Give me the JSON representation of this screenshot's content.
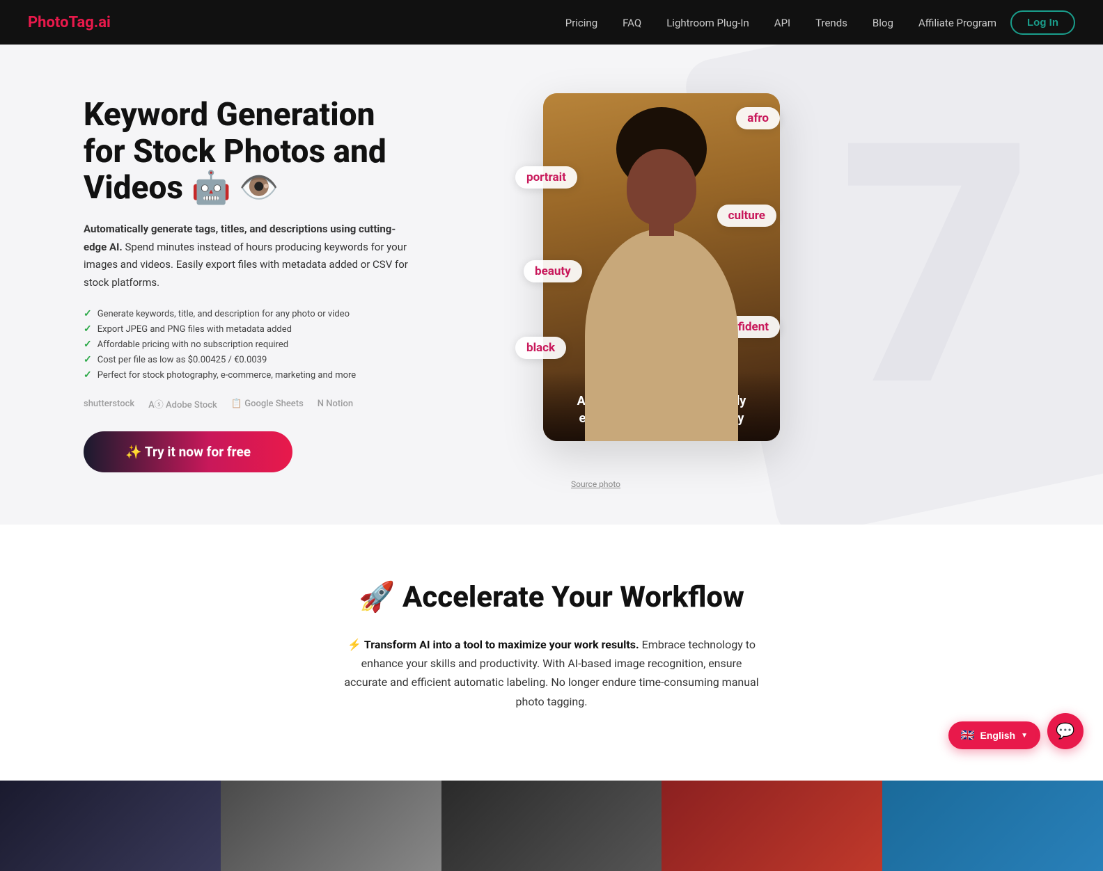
{
  "nav": {
    "logo_photo": "Photo",
    "logo_tag": "Tag",
    "logo_ai": ".ai",
    "links": [
      {
        "label": "Pricing",
        "href": "#"
      },
      {
        "label": "FAQ",
        "href": "#"
      },
      {
        "label": "Lightroom Plug-In",
        "href": "#"
      },
      {
        "label": "API",
        "href": "#"
      },
      {
        "label": "Trends",
        "href": "#"
      },
      {
        "label": "Blog",
        "href": "#"
      },
      {
        "label": "Affiliate Program",
        "href": "#"
      }
    ],
    "login_label": "Log In"
  },
  "hero": {
    "title": "Keyword Generation for Stock Photos and Videos 🤖 👁️",
    "desc_bold": "Automatically generate tags, titles, and descriptions using cutting-edge AI.",
    "desc_rest": " Spend minutes instead of hours producing keywords for your images and videos. Easily export files with metadata added or CSV for stock platforms.",
    "features": [
      "Generate keywords, title, and description for any photo or video",
      "Export JPEG and PNG files with metadata added",
      "Affordable pricing with no subscription required",
      "Cost per file as low as $0.00425 / €0.0039",
      "Perfect for stock photography, e-commerce, marketing and more"
    ],
    "partners": [
      "Shutterstock",
      "Adobe Stock",
      "Google Sheets",
      "Notion"
    ],
    "cta_label": "✨ Try it now for free",
    "photo_tags": [
      "afro",
      "portrait",
      "culture",
      "beauty",
      "confident",
      "black"
    ],
    "photo_description": "A woman with an Afro proudly embracing her natural beauty",
    "source_photo": "Source photo"
  },
  "accelerate": {
    "emoji": "🚀",
    "title": "Accelerate Your Workflow",
    "desc_bold": "Transform AI into a tool to maximize your work results.",
    "desc_rest": " Embrace technology to enhance your skills and productivity. With AI-based image recognition, ensure accurate and efficient automatic labeling. No longer endure time-consuming manual photo tagging."
  },
  "lang_btn": {
    "flag": "🇬🇧",
    "label": "English",
    "chevron": "▼"
  },
  "chat_btn": {
    "icon": "💬"
  }
}
